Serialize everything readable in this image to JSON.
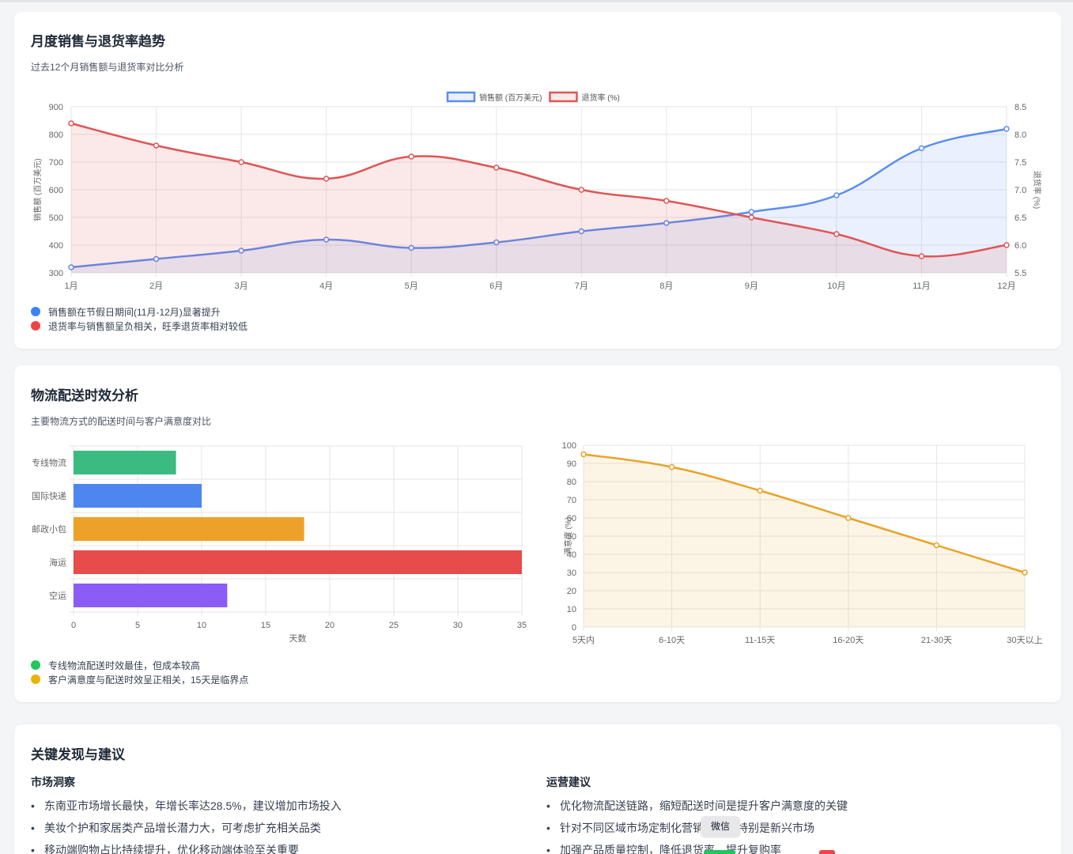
{
  "section1": {
    "title": "月度销售与退货率趋势",
    "subtitle": "过去12个月销售额与退货率对比分析",
    "notes": [
      {
        "text": "销售额在节假日期间(11月-12月)显著提升",
        "color": "#3b82f6"
      },
      {
        "text": "退货率与销售额呈负相关，旺季退货率相对较低",
        "color": "#ef4444"
      }
    ]
  },
  "section2": {
    "title": "物流配送时效分析",
    "subtitle": "主要物流方式的配送时间与客户满意度对比",
    "notes": [
      {
        "text": "专线物流配送时效最佳，但成本较高",
        "color": "#22c55e"
      },
      {
        "text": "客户满意度与配送时效呈正相关，15天是临界点",
        "color": "#eab308"
      }
    ]
  },
  "section3": {
    "title": "关键发现与建议",
    "market": {
      "heading": "市场洞察",
      "items": [
        "东南亚市场增长最快，年增长率达28.5%，建议增加市场投入",
        "美妆个护和家居类产品增长潜力大，可考虑扩充相关品类",
        "移动端购物占比持续提升，优化移动端体验至关重要"
      ]
    },
    "ops": {
      "heading": "运营建议",
      "items": [
        "优化物流配送链路，缩短配送时间是提升客户满意度的关键",
        "针对不同区域市场定制化营销策略，特别是新兴市场",
        "加强产品质量控制，降低退货率，提升复购率"
      ]
    }
  },
  "tooltip": {
    "text": "微信"
  },
  "chart_data": [
    {
      "type": "line",
      "categories": [
        "1月",
        "2月",
        "3月",
        "4月",
        "5月",
        "6月",
        "7月",
        "8月",
        "9月",
        "10月",
        "11月",
        "12月"
      ],
      "series": [
        {
          "name": "销售额 (百万美元)",
          "axis": "left",
          "color": "#5b8def",
          "values": [
            320,
            350,
            380,
            420,
            390,
            410,
            450,
            480,
            520,
            580,
            750,
            820
          ]
        },
        {
          "name": "退货率 (%)",
          "axis": "right",
          "color": "#e05555",
          "values": [
            8.2,
            7.8,
            7.5,
            7.2,
            7.6,
            7.4,
            7.0,
            6.8,
            6.5,
            6.2,
            5.8,
            6.0
          ]
        }
      ],
      "ylabel": "销售额 (百万美元)",
      "y2label": "退货率 (%)",
      "ylim": [
        300,
        900
      ],
      "y2lim": [
        5.5,
        8.5
      ],
      "yticks": [
        300,
        400,
        500,
        600,
        700,
        800,
        900
      ],
      "y2ticks": [
        "5.5",
        "6.0",
        "6.5",
        "7.0",
        "7.5",
        "8.0",
        "8.5"
      ],
      "legend": "top",
      "grid": true
    },
    {
      "type": "bar",
      "orientation": "horizontal",
      "categories": [
        "专线物流",
        "国际快递",
        "邮政小包",
        "海运",
        "空运"
      ],
      "values": [
        8,
        10,
        18,
        35,
        12
      ],
      "colors": [
        "#3bba82",
        "#4e86f0",
        "#eea129",
        "#e74b4b",
        "#8b5cf6"
      ],
      "xlabel": "天数",
      "xlim": [
        0,
        35
      ],
      "xticks": [
        0,
        5,
        10,
        15,
        20,
        25,
        30,
        35
      ],
      "grid": true
    },
    {
      "type": "line",
      "categories": [
        "5天内",
        "6-10天",
        "11-15天",
        "16-20天",
        "21-30天",
        "30天以上"
      ],
      "values": [
        95,
        88,
        75,
        60,
        45,
        30
      ],
      "color": "#e9a329",
      "ylabel": "满意度 (%)",
      "ylim": [
        0,
        100
      ],
      "yticks": [
        0,
        10,
        20,
        30,
        40,
        50,
        60,
        70,
        80,
        90,
        100
      ],
      "grid": true
    }
  ]
}
